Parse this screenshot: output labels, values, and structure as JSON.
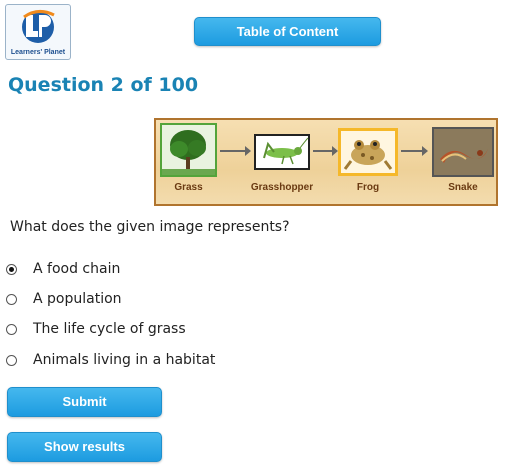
{
  "logo": {
    "caption": "Learners' Planet"
  },
  "header": {
    "toc_label": "Table of Content"
  },
  "question": {
    "title": "Question 2 of 100",
    "text": "What does the given image represents?",
    "diagram": {
      "items": [
        {
          "label": "Grass",
          "icon": "grass-icon"
        },
        {
          "label": "Grasshopper",
          "icon": "grasshopper-icon"
        },
        {
          "label": "Frog",
          "icon": "frog-icon"
        },
        {
          "label": "Snake",
          "icon": "snake-icon"
        }
      ]
    },
    "options": [
      {
        "label": "A food chain",
        "selected": true
      },
      {
        "label": "A population",
        "selected": false
      },
      {
        "label": "The life cycle of grass",
        "selected": false
      },
      {
        "label": "Animals living in a habitat",
        "selected": false
      }
    ],
    "selected_index": 0
  },
  "actions": {
    "submit_label": "Submit",
    "results_label": "Show results"
  }
}
